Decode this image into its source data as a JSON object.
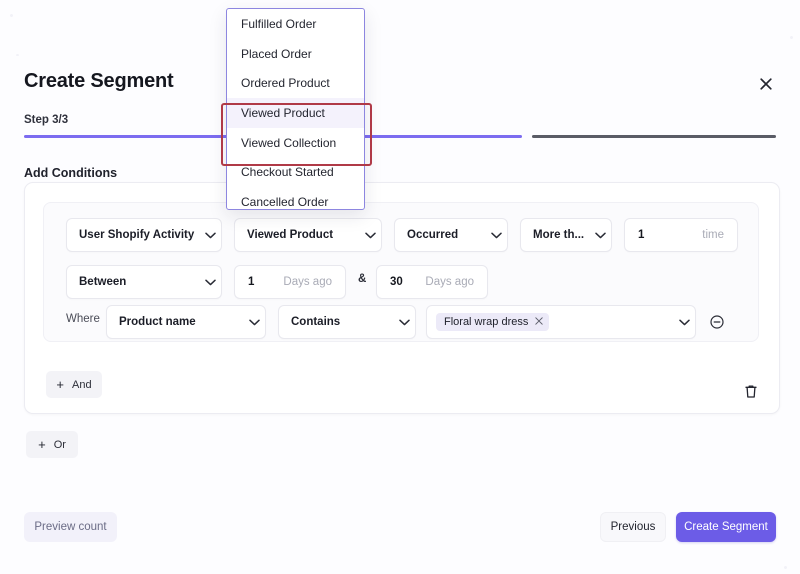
{
  "header": {
    "title": "Create Segment",
    "close_icon": "close-icon",
    "step_label": "Step 3/3"
  },
  "progress": {
    "filled_color": "#7c6cf0",
    "rest_color": "#5a5c66",
    "percent": 67
  },
  "section": {
    "title": "Add Conditions"
  },
  "condition": {
    "row1": {
      "activity": "User Shopify Activity",
      "event": "Viewed Product",
      "occurrence": "Occurred",
      "comparator": "More th...",
      "count_value": "1",
      "count_unit": "time"
    },
    "row2": {
      "timeframe": "Between",
      "from_value": "1",
      "from_unit": "Days ago",
      "conjunction": "&",
      "to_value": "30",
      "to_unit": "Days ago"
    },
    "row3": {
      "where_label": "Where",
      "field": "Product name",
      "operator": "Contains",
      "tags": [
        {
          "label": "Floral wrap dress",
          "remove_icon": "close-small-icon"
        }
      ],
      "remove_condition_icon": "circle-minus-icon"
    },
    "add_and_label": "And",
    "add_or_label": "Or",
    "plus_icon": "plus-icon",
    "delete_group_icon": "trash-icon"
  },
  "footer": {
    "preview_label": "Preview count",
    "previous_label": "Previous",
    "create_label": "Create Segment",
    "create_color": "#6c5ce7"
  },
  "dropdown": {
    "open": true,
    "selected": "Viewed Product",
    "highlight_color": "#b03a47",
    "border_color": "#8d86e0",
    "items": [
      {
        "label": "Fulfilled Order"
      },
      {
        "label": "Placed Order"
      },
      {
        "label": "Ordered Product"
      },
      {
        "label": "Viewed Product"
      },
      {
        "label": "Viewed Collection"
      },
      {
        "label": "Checkout Started"
      },
      {
        "label": "Cancelled Order"
      }
    ]
  }
}
